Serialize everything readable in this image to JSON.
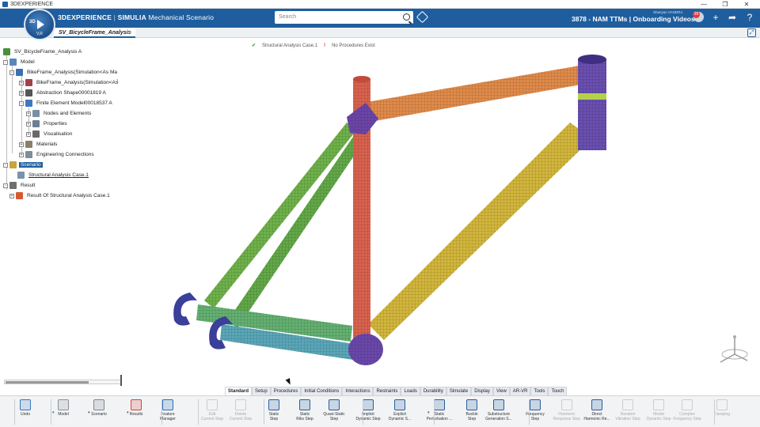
{
  "os": {
    "title": "3DEXPERIENCE",
    "minimize": "—",
    "maximize": "❐",
    "close": "✕"
  },
  "header": {
    "brand_3d": "3DEXPERIENCE",
    "brand_sep": " | ",
    "brand_simulia": "SIMULIA",
    "brand_app": " Mechanical Scenario",
    "compass_label": "3D",
    "compass_version": "V,R",
    "search_placeholder": "Search",
    "context": "3878 - NAM TTMs | Onboarding Videos ⌄",
    "user_name": "Shanyao VANDRA",
    "notif_count": "99",
    "accent": "#1f5e9e"
  },
  "tab": {
    "label": "SV_BicycleFrame_Analysis",
    "add": "+",
    "fit": "⤢"
  },
  "status": {
    "case": "Structural Analysis Case.1",
    "procedures": "No Procedures Exist",
    "ok_icon": "✔",
    "warn_icon": "!"
  },
  "tree": {
    "top_tick": "1",
    "root": "SV_BicycleFrame_Analysis A",
    "model": "Model",
    "sim": "BikeFrame_Analysis(Simulation<As Ma",
    "sim2": "BikeFrame_Analysis(Simulation<As",
    "abstraction": "Abstraction Shape00001819 A",
    "fem": "Finite Element Model00018537 A",
    "nodes": "Nodes and Elements",
    "properties": "Properties",
    "visualisation": "Visualisation",
    "materials": "Materials",
    "engineering": "Engineering Connections",
    "scenario": "Scenario",
    "case": "Structural Analysis Case.1",
    "result": "Result",
    "result_of": "Result Of Structural Analysis Case.1"
  },
  "sections": [
    "Standard",
    "Setup",
    "Procedures",
    "Initial Conditions",
    "Interactions",
    "Restraints",
    "Loads",
    "Durability",
    "Simulate",
    "Display",
    "View",
    "AR-VR",
    "Tools",
    "Touch"
  ],
  "active_section": "Standard",
  "tools": [
    {
      "l1": "Undo",
      "l2": "",
      "icon": "undo-icon",
      "color": "#3b78b8",
      "dis": false
    },
    {
      "l1": "Model",
      "l2": "",
      "icon": "model-icon",
      "color": "#8c9196",
      "dis": false
    },
    {
      "l1": "Scenario",
      "l2": "",
      "icon": "scenario-icon",
      "color": "#7d8792",
      "dis": false
    },
    {
      "l1": "Results",
      "l2": "",
      "icon": "results-icon",
      "color": "#d9423a",
      "dis": false
    },
    {
      "l1": "Feature",
      "l2": "Manager",
      "icon": "feature-manager-icon",
      "color": "#2e6db3",
      "dis": false
    },
    {
      "l1": "Edit",
      "l2": "Current Step",
      "icon": "edit-step-icon",
      "color": "#888",
      "dis": true
    },
    {
      "l1": "Delete",
      "l2": "Current Step",
      "icon": "delete-step-icon",
      "color": "#888",
      "dis": true
    },
    {
      "l1": "Static",
      "l2": "Step",
      "icon": "static-step-icon",
      "color": "#2a5f99",
      "dis": false
    },
    {
      "l1": "Static",
      "l2": "Riks Step",
      "icon": "static-riks-icon",
      "color": "#2a5f99",
      "dis": false
    },
    {
      "l1": "Quasi-Static",
      "l2": "Step",
      "icon": "quasi-static-icon",
      "color": "#2a5f99",
      "dis": false
    },
    {
      "l1": "Implicit",
      "l2": "Dynamic Step",
      "icon": "implicit-dynamic-icon",
      "color": "#2a5f99",
      "dis": false
    },
    {
      "l1": "Explicit",
      "l2": "Dynamic S...",
      "icon": "explicit-dynamic-icon",
      "color": "#2a5f99",
      "dis": false
    },
    {
      "l1": "Static",
      "l2": "Perturbation ...",
      "icon": "static-perturbation-icon",
      "color": "#2a5f99",
      "dis": false
    },
    {
      "l1": "Buckle",
      "l2": "Step",
      "icon": "buckle-step-icon",
      "color": "#2a5f99",
      "dis": false
    },
    {
      "l1": "Substructure",
      "l2": "Generation S...",
      "icon": "substructure-icon",
      "color": "#2a5f99",
      "dis": false
    },
    {
      "l1": "Frequency",
      "l2": "Step",
      "icon": "frequency-step-icon",
      "color": "#2a5f99",
      "dis": false
    },
    {
      "l1": "Harmonic",
      "l2": "Response Step",
      "icon": "harmonic-response-icon",
      "color": "#888",
      "dis": true
    },
    {
      "l1": "Direct",
      "l2": "Harmonic Re...",
      "icon": "direct-harmonic-icon",
      "color": "#2a5f99",
      "dis": false
    },
    {
      "l1": "Random",
      "l2": "Vibration Step",
      "icon": "random-vibration-icon",
      "color": "#888",
      "dis": true
    },
    {
      "l1": "Modal",
      "l2": "Dynamic Step",
      "icon": "modal-dynamic-icon",
      "color": "#888",
      "dis": true
    },
    {
      "l1": "Complex",
      "l2": "Frequency Step",
      "icon": "complex-frequency-icon",
      "color": "#888",
      "dis": true
    },
    {
      "l1": "Damping",
      "l2": "",
      "icon": "damping-icon",
      "color": "#888",
      "dis": true
    }
  ]
}
